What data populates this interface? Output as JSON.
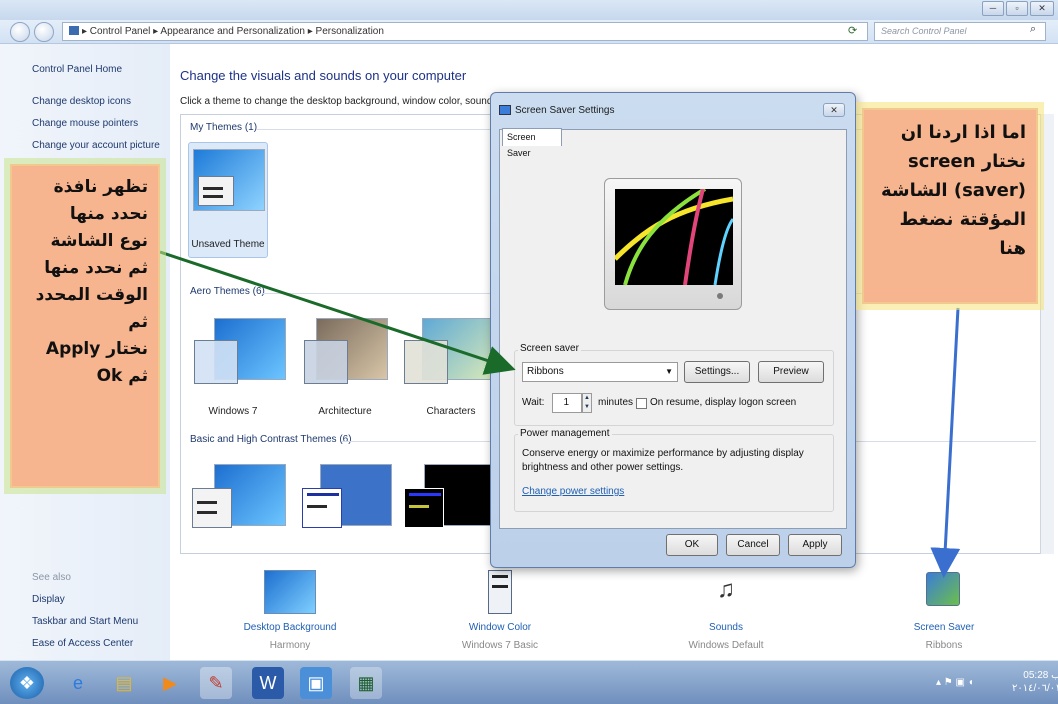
{
  "window": {
    "controls": [
      "─",
      "▫",
      "✕"
    ]
  },
  "address": {
    "path": "▸  Control Panel  ▸  Appearance and Personalization  ▸  Personalization",
    "search_placeholder": "Search Control Panel"
  },
  "left_pane": {
    "links": [
      "Control Panel Home",
      "Change desktop icons",
      "Change mouse pointers",
      "Change your account picture"
    ],
    "see_also_title": "See also",
    "see_also": [
      "Display",
      "Taskbar and Start Menu",
      "Ease of Access Center"
    ]
  },
  "main": {
    "heading": "Change the visuals and sounds on your computer",
    "subheading": "Click a theme to change the desktop background, window color, sounds, and",
    "sections": {
      "my_themes": "My Themes (1)",
      "aero_themes": "Aero Themes (6)",
      "basic_themes": "Basic and High Contrast Themes (6)"
    },
    "themes": {
      "unsaved": "Unsaved Theme",
      "windows7": "Windows 7",
      "architecture": "Architecture",
      "characters": "Characters"
    }
  },
  "bottom": {
    "items": [
      {
        "label": "Desktop Background",
        "sub": "Harmony"
      },
      {
        "label": "Window Color",
        "sub": "Windows 7 Basic"
      },
      {
        "label": "Sounds",
        "sub": "Windows Default"
      },
      {
        "label": "Screen Saver",
        "sub": "Ribbons"
      }
    ]
  },
  "dialog": {
    "title": "Screen Saver Settings",
    "close": "✕",
    "tab": "Screen Saver",
    "screensaver_group": "Screen saver",
    "selected_screensaver": "Ribbons",
    "settings_btn": "Settings...",
    "preview_btn": "Preview",
    "wait_label": "Wait:",
    "wait_value": "1",
    "minutes_label": "minutes",
    "resume_label": "On resume, display logon screen",
    "power_group": "Power management",
    "power_text_1": "Conserve energy or maximize performance by adjusting display",
    "power_text_2": "brightness and other power settings.",
    "power_link": "Change power settings",
    "ok_btn": "OK",
    "cancel_btn": "Cancel",
    "apply_btn": "Apply"
  },
  "callouts": {
    "left_lines": [
      "تظهر نافذة",
      "نحدد منها",
      "نوع الشاشة",
      "ثم نحدد منها",
      "الوقت المحدد",
      "ثم",
      "نختار Apply",
      "ثم Ok"
    ],
    "right_lines": [
      "اما اذا اردنا ان",
      "نختار  screen",
      "(saver) الشاشة",
      "المؤقتة نضغط هنا"
    ]
  },
  "taskbar": {
    "clock_time": "05:28 ب",
    "clock_date": "٢٠١٤/٠٦/٠١"
  },
  "colors": {
    "callout_fill": "#f7b58f",
    "arrow_green": "#1a6b2a",
    "arrow_blue": "#3a6fd0",
    "link_blue": "#1e5fb4"
  }
}
